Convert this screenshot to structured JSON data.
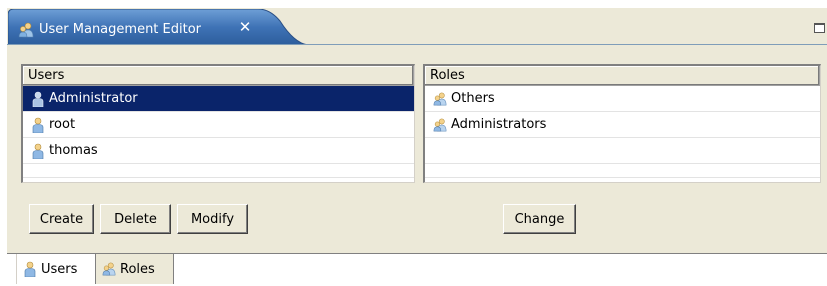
{
  "editor_tab": {
    "title": "User Management Editor",
    "close_glyph": "✕",
    "icon": "users-group-icon"
  },
  "users_list": {
    "header": "Users",
    "items": [
      {
        "label": "Administrator",
        "icon": "user-icon",
        "selected": true
      },
      {
        "label": "root",
        "icon": "user-icon",
        "selected": false
      },
      {
        "label": "thomas",
        "icon": "user-icon",
        "selected": false
      }
    ]
  },
  "roles_list": {
    "header": "Roles",
    "items": [
      {
        "label": "Others",
        "icon": "role-group-icon"
      },
      {
        "label": "Administrators",
        "icon": "role-group-icon"
      }
    ]
  },
  "buttons": {
    "create": "Create",
    "delete": "Delete",
    "modify": "Modify",
    "change": "Change"
  },
  "view_tabs": [
    {
      "label": "Users",
      "icon": "user-icon",
      "active": true
    },
    {
      "label": "Roles",
      "icon": "role-group-icon",
      "active": false
    }
  ],
  "colors": {
    "tab_blue": "#3a6ea5",
    "selection": "#0a246a",
    "panel": "#ece9d8"
  }
}
